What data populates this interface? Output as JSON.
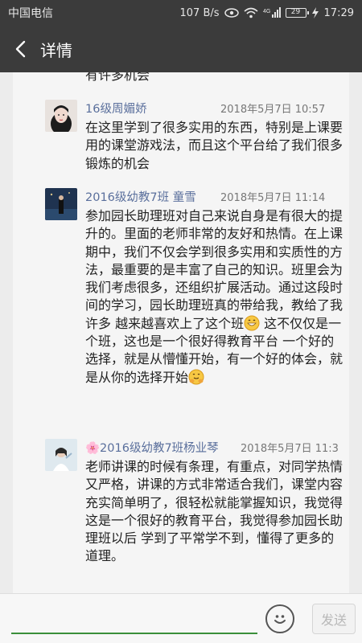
{
  "status_bar": {
    "carrier": "中国电信",
    "speed": "107 B/s",
    "network": "4G",
    "battery": "29",
    "time": "17:29"
  },
  "header": {
    "title": "详情"
  },
  "partial_text": "有许多机会",
  "comments": [
    {
      "name": "16级周媚娇",
      "time": "2018年5月7日 10:57",
      "body": "在这里学到了很多实用的东西，特别是上课要用的课堂游戏法，而且这个平台给了我们很多锻炼的机会"
    },
    {
      "name": "2016级幼教7班 童雪",
      "time": "2018年5月7日 11:14",
      "body_a": "参加园长助理班对自己来说自身是有很大的提升的。里面的老师非常的友好和热情。在上课期中，我们不仅会学到很多实用和实质性的方法，最重要的是丰富了自己的知识。班里会为我们考虑很多，还组织扩展活动。通过这段时间的学习，园长助理班真的带给我，教给了我许多  越来越喜欢上了这个班",
      "body_b": "  这不仅仅是一个班，这也是一个很好得教育平台   一个好的选择，就是从懵懂开始，有一个好的体会，就是从你的选择开始"
    },
    {
      "name": "🌸2016级幼教7班杨业琴",
      "time": "2018年5月7日 11:3",
      "body": "老师讲课的时候有条理，有重点，对同学热情又严格，讲课的方式非常适合我们，课堂内容充实简单明了，很轻松就能掌握知识，我觉得这是一个很好的教育平台，我觉得参加园长助理班以后 学到了平常学不到，懂得了更多的道理。"
    }
  ],
  "compose": {
    "placeholder": "",
    "send_label": "发送"
  },
  "colors": {
    "bar": "#3b3b3b",
    "name_link": "#5a6f9c",
    "input_underline": "#3a8f3a"
  }
}
